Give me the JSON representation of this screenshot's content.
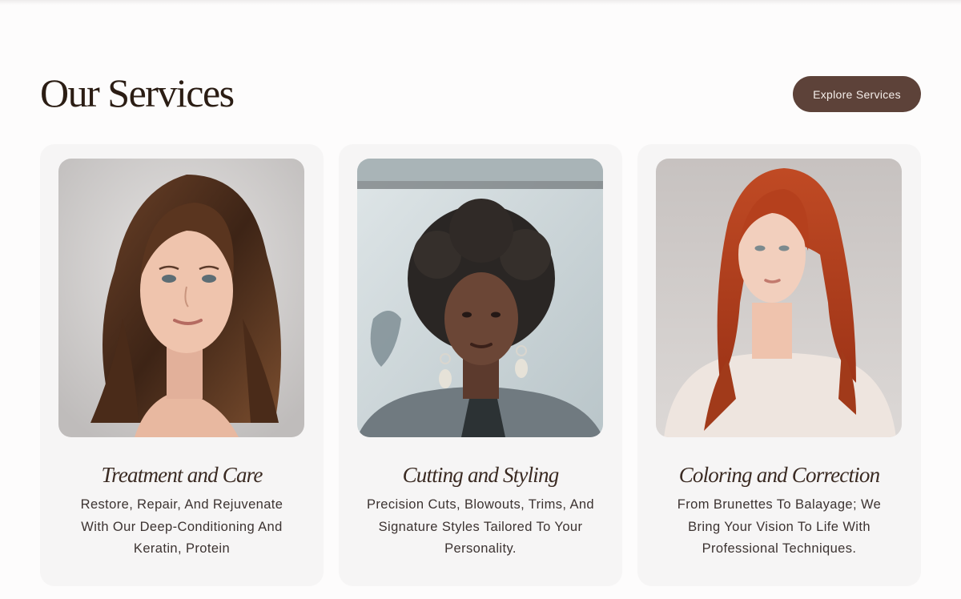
{
  "section": {
    "title": "Our Services",
    "cta_label": "Explore Services"
  },
  "colors": {
    "accent": "#5d4239",
    "card_bg": "#f6f5f5",
    "title_text": "#2b1d14"
  },
  "services": [
    {
      "title": "Treatment and Care",
      "description": "Restore, Repair, And Rejuvenate With Our Deep-Conditioning And Keratin, Protein",
      "image": "portrait-wavy-brown-hair"
    },
    {
      "title": "Cutting and Styling",
      "description": "Precision Cuts, Blowouts, Trims, And Signature Styles Tailored To Your Personality.",
      "image": "portrait-curly-black-hair"
    },
    {
      "title": "Coloring and Correction",
      "description": "From Brunettes To Balayage; We Bring Your Vision To Life With Professional Techniques.",
      "image": "portrait-copper-red-hair"
    }
  ]
}
